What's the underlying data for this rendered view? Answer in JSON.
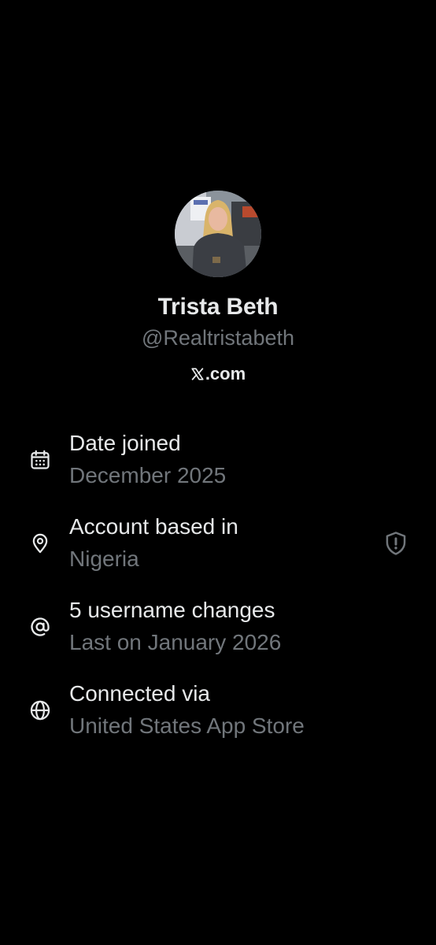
{
  "profile": {
    "display_name": "Trista Beth",
    "handle": "@Realtristabeth",
    "site_label": ".com",
    "site_logo_icon": "x-logo-icon"
  },
  "info": [
    {
      "icon": "calendar-icon",
      "title": "Date joined",
      "subtitle": "December 2025"
    },
    {
      "icon": "location-pin-icon",
      "title": "Account based in",
      "subtitle": "Nigeria",
      "badge_icon": "shield-alert-icon"
    },
    {
      "icon": "at-sign-icon",
      "title": "5 username changes",
      "subtitle": "Last on January 2026"
    },
    {
      "icon": "globe-icon",
      "title": "Connected via",
      "subtitle": "United States App Store"
    }
  ],
  "colors": {
    "background": "#000000",
    "primary_text": "#e7e9ea",
    "secondary_text": "#71767b"
  }
}
